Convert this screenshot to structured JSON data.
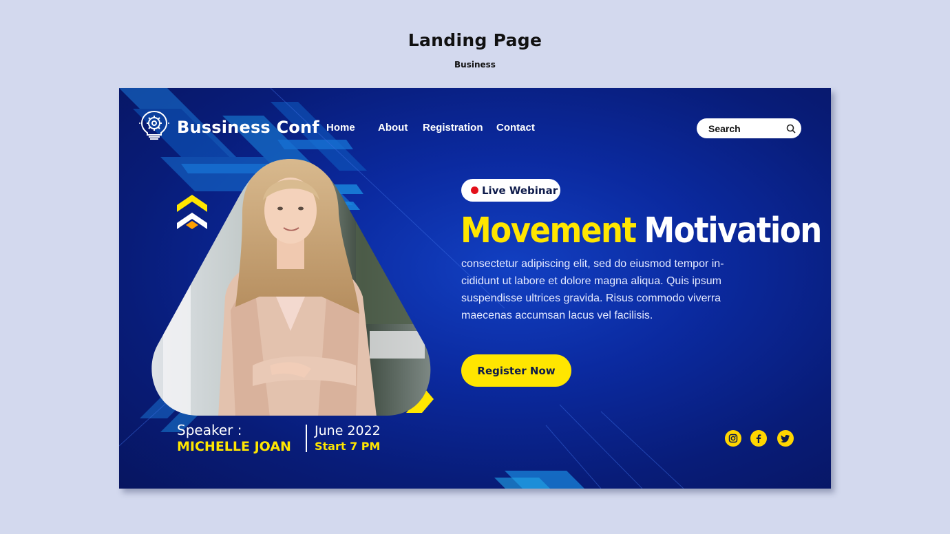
{
  "page": {
    "title": "Landing Page",
    "subtitle": "Business"
  },
  "header": {
    "logo_text": "Bussiness Conf",
    "logo_icon": "lightbulb-gear-icon",
    "nav": [
      "Home",
      "About",
      "Registration",
      "Contact"
    ],
    "search_label": "Search",
    "search_icon": "search-icon"
  },
  "hero": {
    "badge": "Live Webinar",
    "headline_yellow": "Movement",
    "headline_white": "Motivation",
    "body_lines": [
      "consectetur adipiscing elit, sed do eiusmod tempor in-",
      "cididunt ut labore et dolore magna aliqua. Quis ipsum",
      "suspendisse ultrices gravida. Risus commodo viverra",
      "maecenas accumsan lacus vel facilisis."
    ],
    "cta": "Register Now"
  },
  "event": {
    "speaker_label": "Speaker :",
    "speaker_name": "MICHELLE JOAN",
    "date": "June 2022",
    "time": "Start 7 PM"
  },
  "social": [
    "instagram-icon",
    "facebook-icon",
    "twitter-icon"
  ],
  "colors": {
    "background": "#d3d9ee",
    "banner_blue": "#0b2aa0",
    "accent_yellow": "#ffe600",
    "live_red": "#e3101a"
  }
}
